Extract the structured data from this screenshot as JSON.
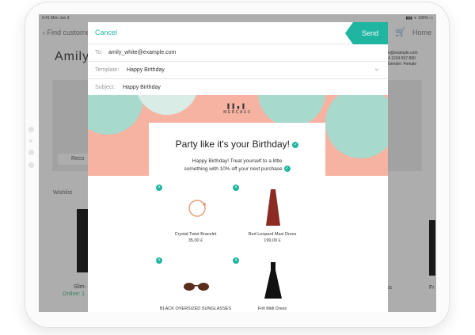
{
  "status_bar": {
    "time": "9:41  Mon Jun 3",
    "right": "▮▮▮ ᯤ 100% ▭"
  },
  "background": {
    "back_label": "Find customer",
    "home_label": "Home",
    "customer_name": "Amily",
    "info_lines": [
      "e@example.com",
      "4 1234 567 890",
      "Gender: Female"
    ],
    "card_button": "Reco",
    "wishlist_label": "Wishlist",
    "item_name": "Slim-",
    "online_label": "Online: 1",
    "right_item_name": "ss",
    "right_item_name2": "Fr"
  },
  "modal": {
    "cancel_label": "Cancel",
    "send_label": "Send",
    "to": {
      "label": "To:",
      "value": "amily_white@example.com"
    },
    "template": {
      "label": "Template:",
      "value": "Happy Birthday"
    },
    "subject": {
      "label": "Subject:",
      "value": "Happy Birthday"
    }
  },
  "email": {
    "brand": "MERCAUX",
    "headline": "Party like it's your Birthday!",
    "message_line1": "Happy Birthday! Treat yourself to a little",
    "message_line2": "something with 10% off your next purchase",
    "products": [
      {
        "name": "Crystal Twist Bracelet",
        "price": "35,00 £"
      },
      {
        "name": "Red Leopard Maxi Dress",
        "price": "199,00 £"
      },
      {
        "name": "BLACK OVERSIZED SUNGLASSES",
        "price": ""
      },
      {
        "name": "Frill Midi Dress",
        "price": ""
      }
    ]
  },
  "colors": {
    "accent": "#1fb5a1",
    "hero_bg": "#f6b3a2",
    "balloon": "#a8d9cd"
  }
}
